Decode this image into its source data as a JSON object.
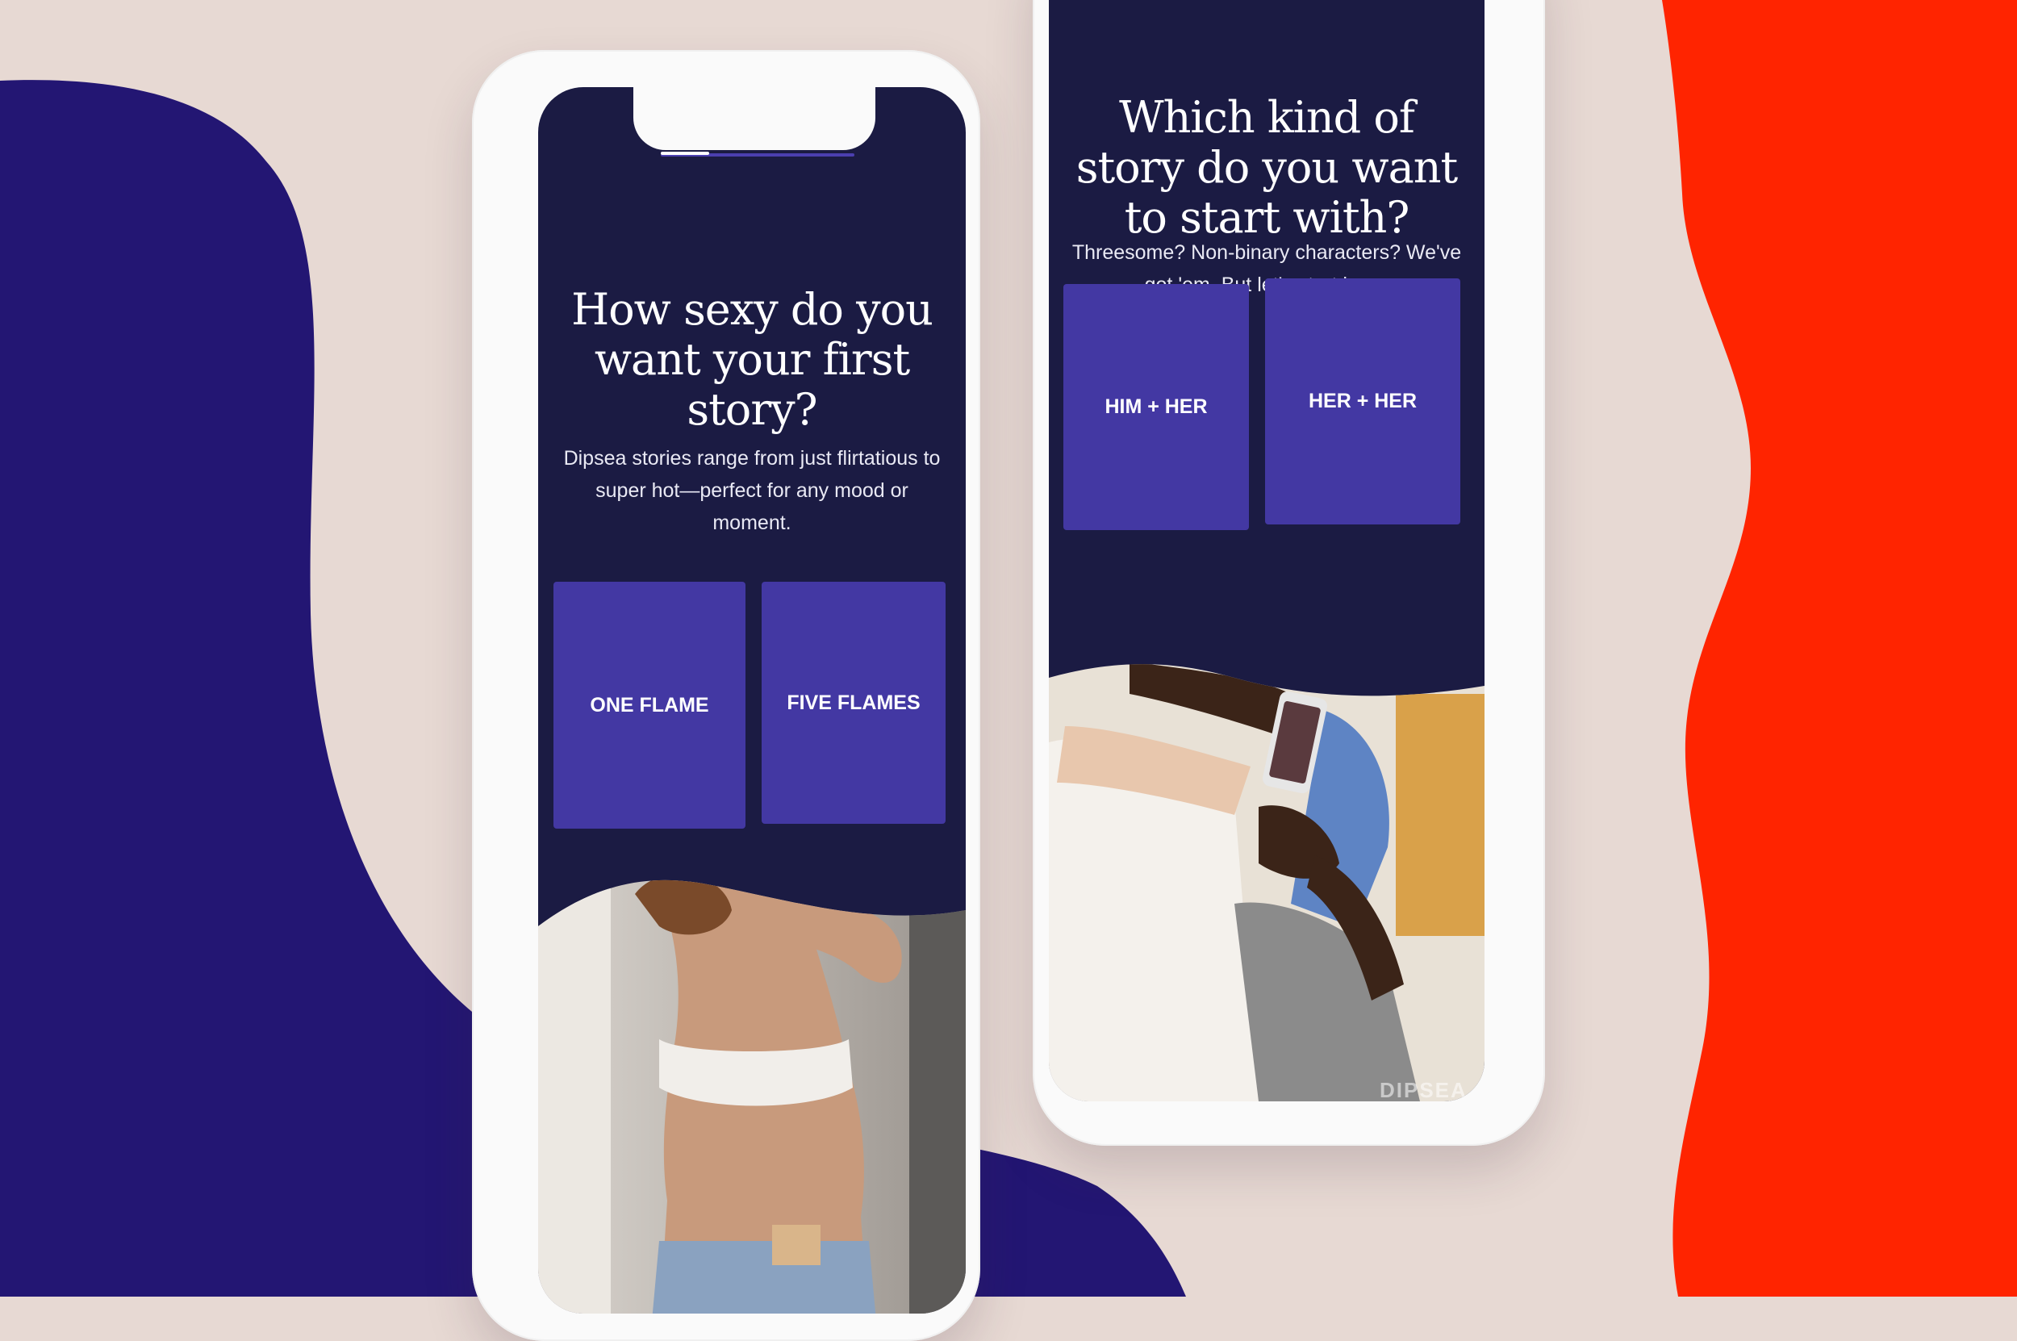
{
  "colors": {
    "background": "#e7d9d3",
    "blob_blue": "#231673",
    "blob_red": "#ff2400",
    "screen_bg": "#1b1b43",
    "choice_bg": "#4338a3",
    "phone_frame": "#fafafa"
  },
  "phone_left": {
    "progress": {
      "current_step": 1,
      "total_steps": 4
    },
    "title": "How sexy do you want your first story?",
    "subtitle": "Dipsea stories range from just flirtatious to super hot—perfect for any mood or moment.",
    "options": [
      {
        "label": "ONE FLAME"
      },
      {
        "label": "FIVE FLAMES"
      }
    ],
    "image_icon": "woman-in-white-bra-photo"
  },
  "phone_right": {
    "title": "Which kind of story do you want to start with?",
    "subtitle": "Threesome? Non-binary characters? We've got 'em. But let's start here.",
    "options": [
      {
        "label": "HIM + HER"
      },
      {
        "label": "HER + HER"
      }
    ],
    "image_icon": "couple-with-phone-photo",
    "watermark": "DIPSEA"
  }
}
